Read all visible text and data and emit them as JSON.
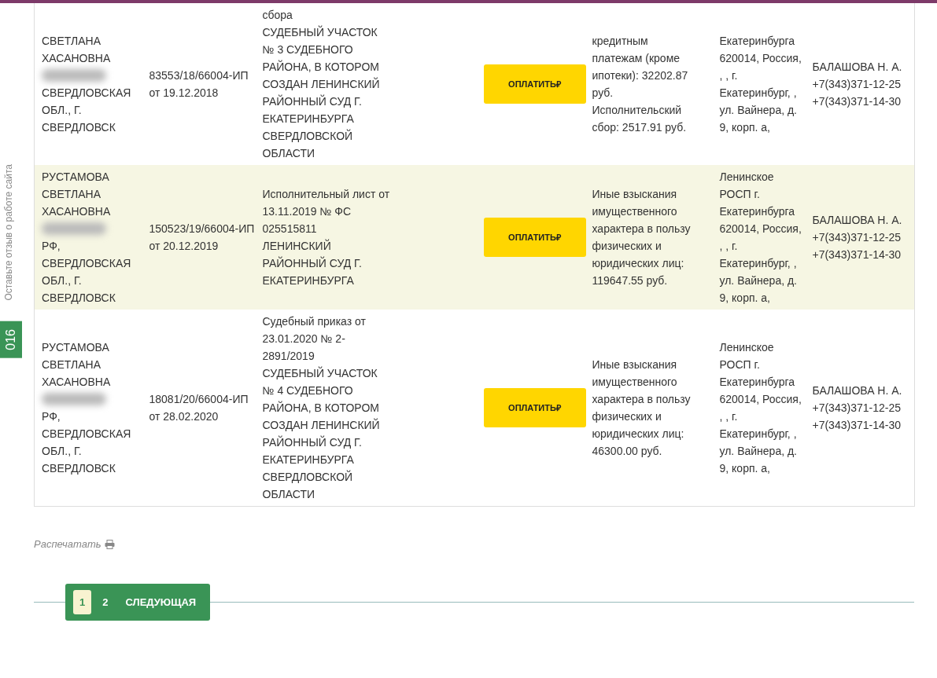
{
  "feedback_tab": {
    "label": "Оставьте отзыв о работе сайта"
  },
  "year_tab": {
    "label": "016"
  },
  "rows": [
    {
      "shaded": false,
      "debtor": {
        "name": "СВЕТЛАНА ХАСАНОВНА",
        "redacted": true,
        "address": "СВЕРДЛОВСКАЯ ОБЛ., Г. СВЕРДЛОВСК"
      },
      "proceeding": "83553/18/66004-ИП от 19.12.2018",
      "document": "сбора\nСУДЕБНЫЙ УЧАСТОК № 3 СУДЕБНОГО РАЙОНА, В КОТОРОМ СОЗДАН ЛЕНИНСКИЙ РАЙОННЫЙ СУД Г. ЕКАТЕРИНБУРГА СВЕРДЛОВСКОЙ ОБЛАСТИ",
      "pay_button": "ОПЛАТИТЬ₽",
      "subject": "кредитным платежам (кроме ипотеки): 32202.87 руб.\nИсполнительский сбор: 2517.91 руб.",
      "department": "Екатеринбурга 620014, Россия, , , г. Екатеринбург, , ул. Вайнера, д. 9, корп. а,",
      "bailiff": {
        "name": "БАЛАШОВА Н. А.",
        "phones": [
          "+7(343)371-12-25",
          "+7(343)371-14-30"
        ]
      }
    },
    {
      "shaded": true,
      "debtor": {
        "name": "РУСТАМОВА СВЕТЛАНА ХАСАНОВНА",
        "redacted": true,
        "address": "РФ, СВЕРДЛОВСКАЯ ОБЛ., Г. СВЕРДЛОВСК"
      },
      "proceeding": "150523/19/66004-ИП от 20.12.2019",
      "document": "Исполнительный лист от 13.11.2019 № ФС 025515811\nЛЕНИНСКИЙ РАЙОННЫЙ СУД Г. ЕКАТЕРИНБУРГА",
      "pay_button": "ОПЛАТИТЬ₽",
      "subject": "Иные взыскания имущественного характера в пользу физических и юридических лиц: 119647.55 руб.",
      "department": "Ленинское РОСП г. Екатеринбурга 620014, Россия, , , г. Екатеринбург, , ул. Вайнера, д. 9, корп. а,",
      "bailiff": {
        "name": "БАЛАШОВА Н. А.",
        "phones": [
          "+7(343)371-12-25",
          "+7(343)371-14-30"
        ]
      }
    },
    {
      "shaded": false,
      "debtor": {
        "name": "РУСТАМОВА СВЕТЛАНА ХАСАНОВНА",
        "redacted": true,
        "address": "РФ, СВЕРДЛОВСКАЯ ОБЛ., Г. СВЕРДЛОВСК"
      },
      "proceeding": "18081/20/66004-ИП от 28.02.2020",
      "document": "Судебный приказ от 23.01.2020 № 2-2891/2019\nСУДЕБНЫЙ УЧАСТОК № 4 СУДЕБНОГО РАЙОНА, В КОТОРОМ СОЗДАН ЛЕНИНСКИЙ РАЙОННЫЙ СУД Г. ЕКАТЕРИНБУРГА СВЕРДЛОВСКОЙ ОБЛАСТИ",
      "pay_button": "ОПЛАТИТЬ₽",
      "subject": "Иные взыскания имущественного характера в пользу физических и юридических лиц: 46300.00 руб.",
      "department": "Ленинское РОСП г. Екатеринбурга 620014, Россия, , , г. Екатеринбург, , ул. Вайнера, д. 9, корп. а,",
      "bailiff": {
        "name": "БАЛАШОВА Н. А.",
        "phones": [
          "+7(343)371-12-25",
          "+7(343)371-14-30"
        ]
      }
    }
  ],
  "print_link": {
    "label": "Распечатать"
  },
  "pagination": [
    {
      "label": "1",
      "selected": true
    },
    {
      "label": "2",
      "selected": false
    },
    {
      "label": "СЛЕДУЮЩАЯ",
      "selected": false
    }
  ]
}
